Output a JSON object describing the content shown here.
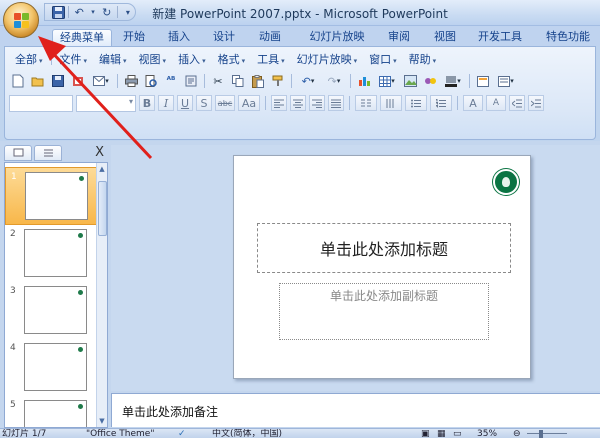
{
  "window": {
    "title": "新建 PowerPoint 2007.pptx - Microsoft PowerPoint"
  },
  "quick_access": {
    "icons": [
      "save-icon",
      "undo-icon",
      "redo-icon",
      "customize-dropdown-icon"
    ]
  },
  "ribbon_tabs": [
    {
      "label": "经典菜单",
      "active": true
    },
    {
      "label": "开始"
    },
    {
      "label": "插入"
    },
    {
      "label": "设计"
    },
    {
      "label": "动画"
    },
    {
      "label": "幻灯片放映"
    },
    {
      "label": "审阅"
    },
    {
      "label": "视图"
    },
    {
      "label": "开发工具"
    },
    {
      "label": "特色功能"
    }
  ],
  "classic_menu": {
    "items": [
      {
        "label": "全部"
      },
      {
        "label": "文件"
      },
      {
        "label": "编辑"
      },
      {
        "label": "视图"
      },
      {
        "label": "插入"
      },
      {
        "label": "格式"
      },
      {
        "label": "工具"
      },
      {
        "label": "幻灯片放映"
      },
      {
        "label": "窗口"
      },
      {
        "label": "帮助"
      }
    ]
  },
  "format_buttons": {
    "bold": "B",
    "italic": "I",
    "underline": "U",
    "shadow": "S",
    "strike": "abc",
    "font_size_increase": "A",
    "font_size_decrease": "A",
    "change_case": "Aa"
  },
  "slides_pane": {
    "close_label": "X",
    "slide_numbers": [
      "1",
      "2",
      "3",
      "4",
      "5"
    ],
    "selected": "1"
  },
  "slide": {
    "title_placeholder": "单击此处添加标题",
    "subtitle_placeholder": "单击此处添加副标题"
  },
  "notes": {
    "placeholder": "单击此处添加备注"
  },
  "status_bar": {
    "slide_info": "幻灯片 1/7",
    "theme": "\"Office Theme\"",
    "language": "中文(简体，中国)",
    "zoom": "35%"
  },
  "colors": {
    "accent_orange": "#f8b74a",
    "annotation_red": "#e0201b",
    "logo_green": "#0b7443"
  }
}
